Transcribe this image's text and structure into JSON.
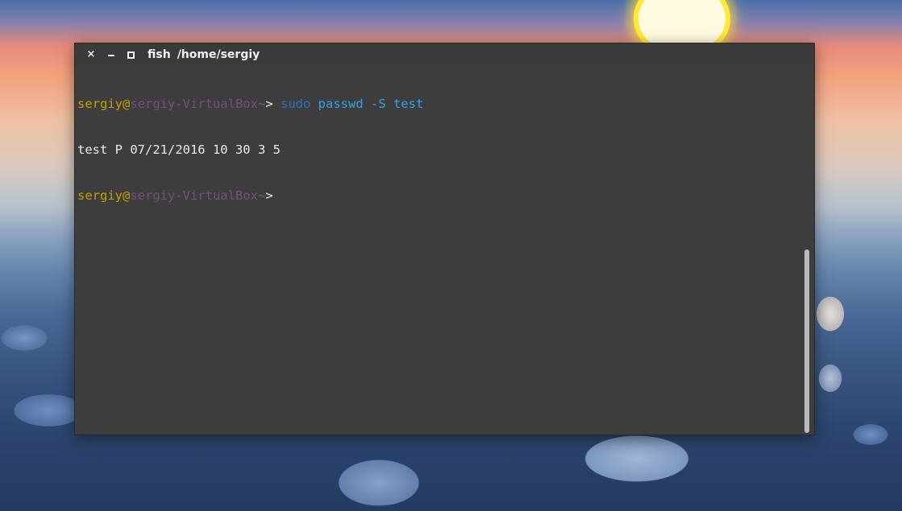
{
  "window": {
    "title_app": "fish",
    "title_path": "/home/sergiy",
    "close_glyph": "×",
    "buttons": [
      "close-icon",
      "minimize-icon",
      "maximize-icon"
    ]
  },
  "terminal": {
    "lines": [
      {
        "user": "sergiy",
        "at": "@",
        "host": "sergiy-VirtualBox",
        "cwd": "~",
        "prompt": "> ",
        "cmd_builtin": "sudo",
        "cmd_rest": " passwd -S test"
      },
      {
        "output": "test P 07/21/2016 10 30 3 5"
      },
      {
        "user": "sergiy",
        "at": "@",
        "host": "sergiy-VirtualBox",
        "cwd": "~",
        "prompt": ">"
      }
    ]
  },
  "colors": {
    "terminal_bg": "#3d3d3d",
    "user": "#c4a000",
    "host": "#75507b",
    "cwd": "#4e7f3a",
    "command": "#34a0e6",
    "sudo": "#2a73c0",
    "text": "#ececec"
  }
}
